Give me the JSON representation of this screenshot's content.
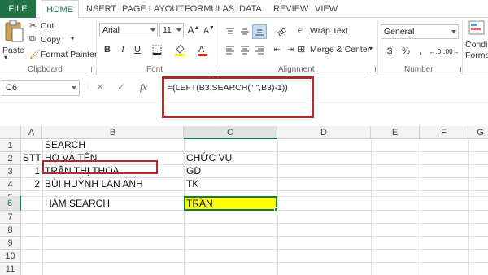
{
  "tabs": [
    "FILE",
    "HOME",
    "INSERT",
    "PAGE LAYOUT",
    "FORMULAS",
    "DATA",
    "REVIEW",
    "VIEW"
  ],
  "ribbon": {
    "clipboard": {
      "paste": "Paste",
      "cut": "Cut",
      "copy": "Copy",
      "format_painter": "Format Painter",
      "label": "Clipboard"
    },
    "font": {
      "name": "Arial",
      "size": "11",
      "bold": "B",
      "italic": "I",
      "underline": "U",
      "label": "Font"
    },
    "alignment": {
      "wrap_text": "Wrap Text",
      "merge_center": "Merge & Center",
      "label": "Alignment"
    },
    "number": {
      "format": "General",
      "label": "Number",
      "currency": "$",
      "percent": "%",
      "comma": ","
    },
    "styles": {
      "conditional_1": "Condi",
      "conditional_2": "Forma"
    }
  },
  "formula_bar": {
    "name_box": "C6",
    "cancel": "✕",
    "enter": "✓",
    "fx": "fx",
    "formula": "=(LEFT(B3,SEARCH(\" \",B3)-1))"
  },
  "columns": [
    "A",
    "B",
    "C",
    "D",
    "E",
    "F",
    "G"
  ],
  "rows": [
    "1",
    "2",
    "3",
    "4",
    "5",
    "6",
    "7",
    "8",
    "9",
    "10",
    "11"
  ],
  "cells": {
    "B1": "SEARCH",
    "A2": "STT",
    "B2": "HỌ VÀ TÊN",
    "C2": "CHỨC VỤ",
    "A3": "1",
    "B3": "TRẦN THỊ THOA",
    "C3": "GD",
    "A4": "2",
    "B4": "BÙI HUỲNH LAN ANH",
    "C4": "TK",
    "B6": "HÀM SEARCH",
    "C6": "TRẦN"
  },
  "colors": {
    "accent": "#217346",
    "highlight": "#ffff00",
    "annotation": "#b02a2e"
  }
}
